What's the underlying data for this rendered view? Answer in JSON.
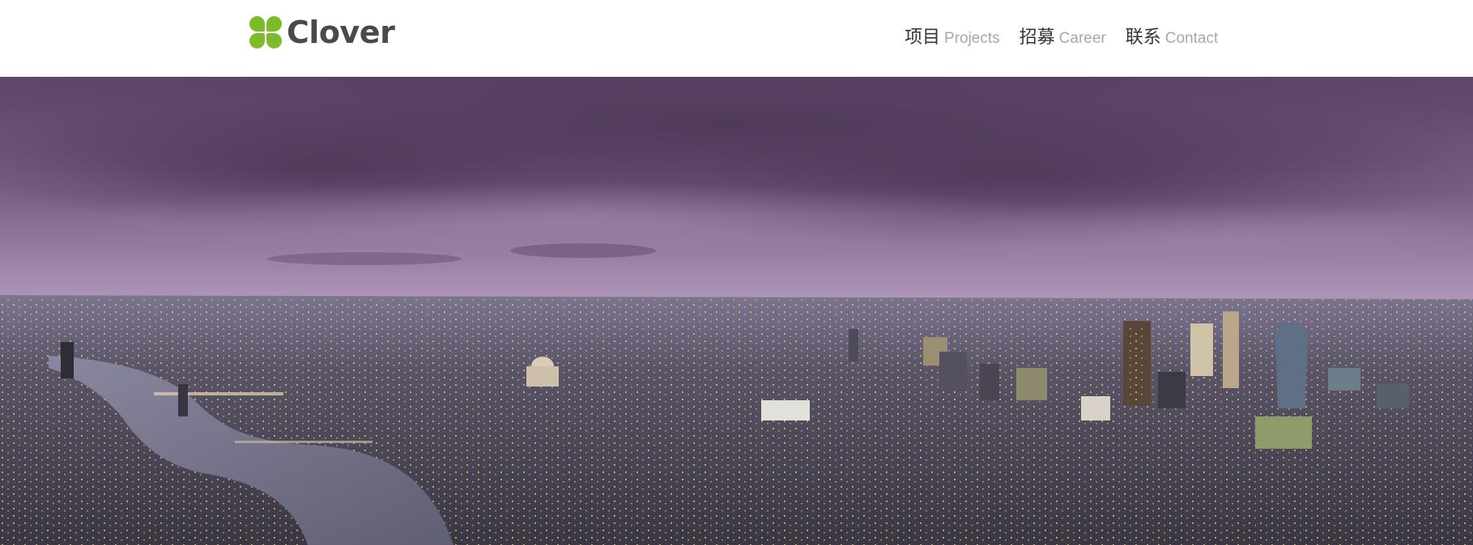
{
  "header": {
    "logo": {
      "text": "Clover",
      "icon": "clover-logo-icon",
      "color": "#7dbb2a"
    },
    "nav": [
      {
        "cn": "项目",
        "en": "Projects"
      },
      {
        "cn": "招募",
        "en": "Career"
      },
      {
        "cn": "联系",
        "en": "Contact"
      }
    ]
  },
  "hero": {
    "image": "aerial-city-skyline-at-dusk",
    "colors": {
      "sky_top": "#6b5175",
      "sky_mid": "#b59bbf",
      "horizon": "#e9b6b8",
      "city": "#3e3e4a",
      "lights": "#f2c46a",
      "river": "#6f6e80"
    }
  }
}
